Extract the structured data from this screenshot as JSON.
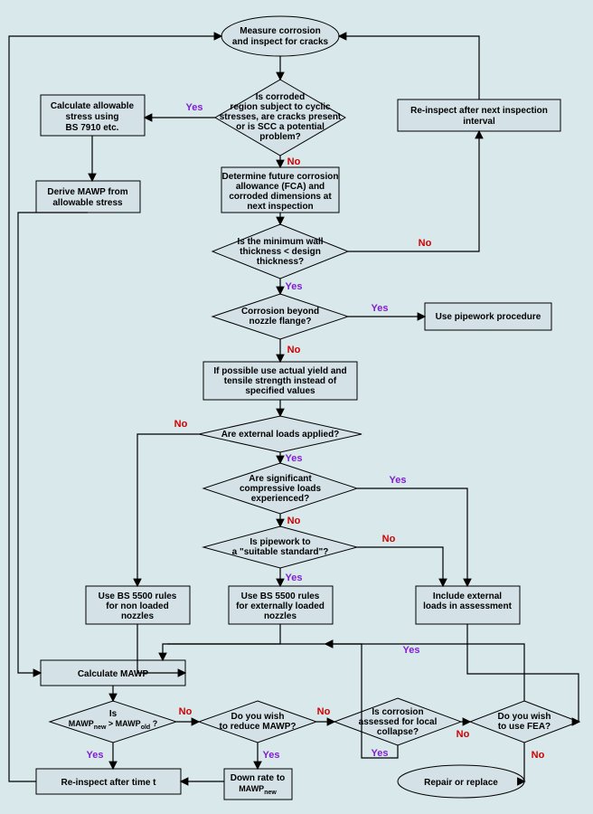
{
  "nodes": {
    "n1": "Measure corrosion\nand inspect for cracks",
    "n2": "Is corroded\nregion subject to cyclic\nstresses, are cracks present\nor is SCC a potential\nproblem?",
    "n3": "Calculate allowable\nstress using\nBS 7910 etc.",
    "n4": "Re-inspect after next inspection\ninterval",
    "n5": "Derive MAWP from\nallowable stress",
    "n6": "Determine future corrosion\nallowance (FCA) and\ncorroded dimensions at\nnext inspection",
    "n7": "Is the minimum wall\nthickness < design\nthickness?",
    "n8": "Corrosion beyond\nnozzle flange?",
    "n9": "Use pipework procedure",
    "n10": "If possible use actual yield and\ntensile strength instead of\nspecified values",
    "n11": "Are external loads applied?",
    "n12": "Are significant\ncompressive loads\nexperienced?",
    "n13": "Is pipework to\na \"suitable standard\"?",
    "n14": "Use BS 5500 rules\nfor non loaded\nnozzles",
    "n15": "Use BS 5500 rules\nfor externally loaded\nnozzles",
    "n16": "Include external\nloads in assessment",
    "n17": "Calculate MAWP",
    "n18": "Is\nMAWP_new > MAWP_old ?",
    "n19": "Do you wish\nto reduce MAWP?",
    "n20": "Is corrosion\nassessed for local\ncollapse?",
    "n21": "Do you wish\nto use FEA?",
    "n22": "Re-inspect after time t",
    "n23": "Down rate to\nMAWP_new",
    "n24": "Repair or replace"
  },
  "labels": {
    "y": "Yes",
    "n": "No"
  },
  "flow": [
    [
      "n1",
      "n2",
      "-"
    ],
    [
      "n2",
      "n3",
      "Yes"
    ],
    [
      "n2",
      "n6",
      "No"
    ],
    [
      "n3",
      "n5",
      "-"
    ],
    [
      "n6",
      "n7",
      "-"
    ],
    [
      "n7",
      "n4",
      "No"
    ],
    [
      "n4",
      "n1",
      "-"
    ],
    [
      "n7",
      "n8",
      "Yes"
    ],
    [
      "n8",
      "n9",
      "Yes"
    ],
    [
      "n8",
      "n10",
      "No"
    ],
    [
      "n10",
      "n11",
      "-"
    ],
    [
      "n11",
      "n14",
      "No"
    ],
    [
      "n11",
      "n12",
      "Yes"
    ],
    [
      "n12",
      "n16",
      "Yes"
    ],
    [
      "n12",
      "n13",
      "No"
    ],
    [
      "n13",
      "n16",
      "No"
    ],
    [
      "n13",
      "n15",
      "Yes"
    ],
    [
      "n14",
      "n17",
      "-"
    ],
    [
      "n15",
      "n17",
      "-"
    ],
    [
      "n16",
      "n21",
      "-"
    ],
    [
      "n5",
      "n17",
      "-"
    ],
    [
      "n17",
      "n18",
      "-"
    ],
    [
      "n18",
      "n22",
      "Yes"
    ],
    [
      "n18",
      "n19",
      "No"
    ],
    [
      "n19",
      "n23",
      "Yes"
    ],
    [
      "n19",
      "n20",
      "No"
    ],
    [
      "n20",
      "n17",
      "Yes"
    ],
    [
      "n20",
      "n21",
      "No"
    ],
    [
      "n21",
      "n17",
      "Yes"
    ],
    [
      "n21",
      "n24",
      "No"
    ],
    [
      "n23",
      "n22",
      "-"
    ],
    [
      "n22",
      "n1",
      "-"
    ]
  ]
}
